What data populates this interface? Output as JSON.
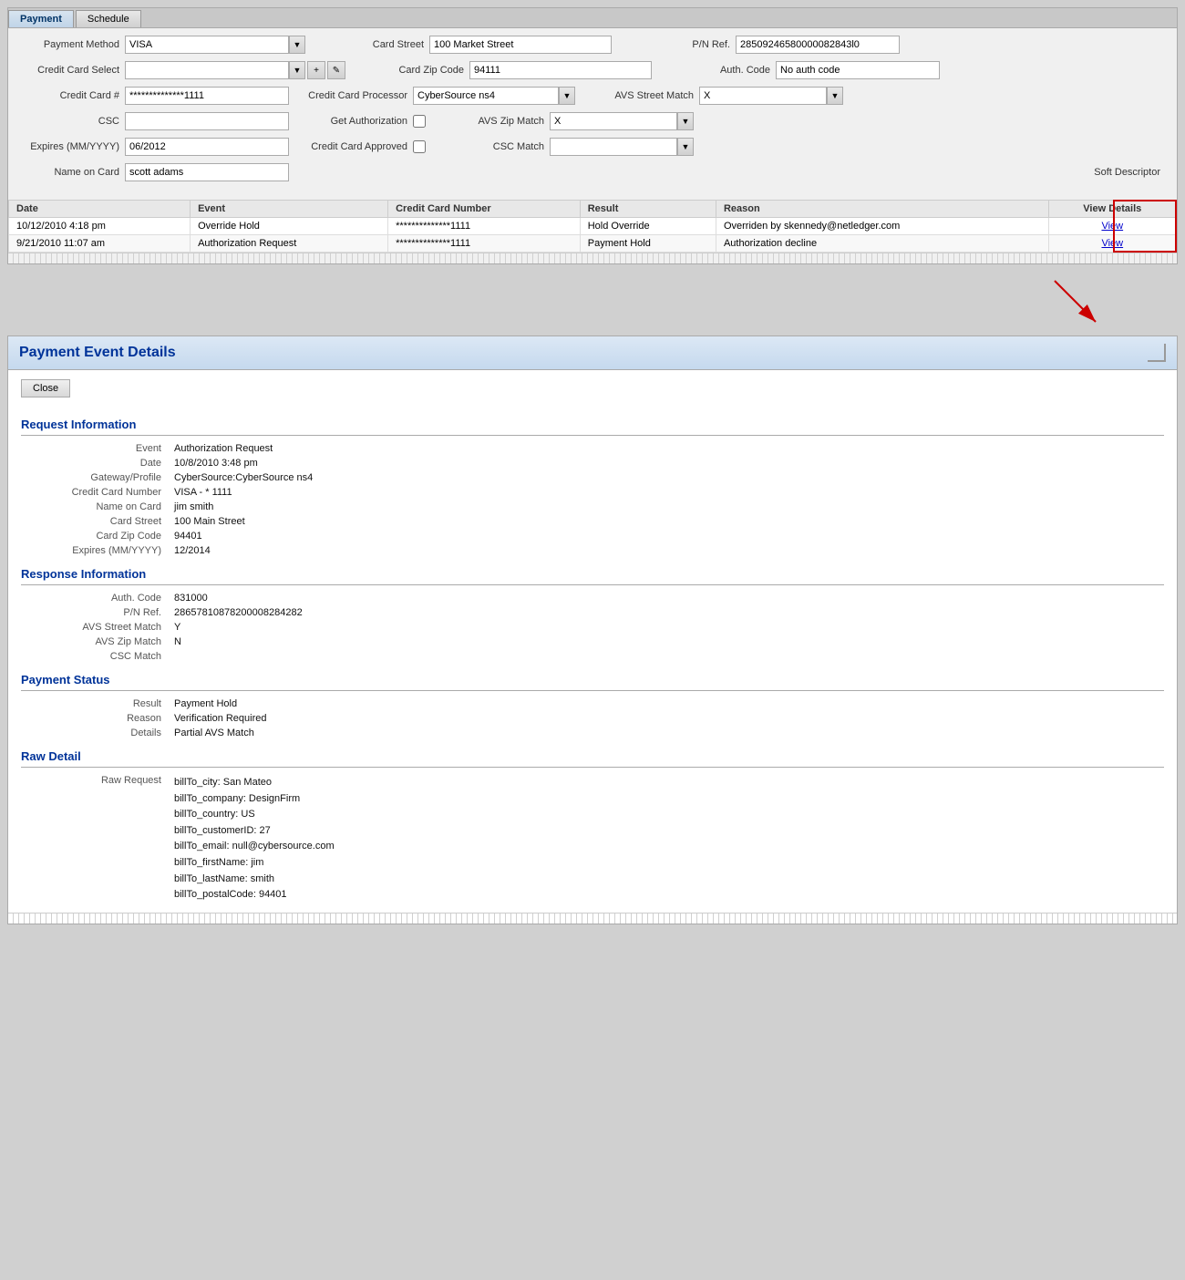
{
  "tabs": [
    {
      "label": "Payment",
      "active": true
    },
    {
      "label": "Schedule",
      "active": false
    }
  ],
  "payment_form": {
    "payment_method_label": "Payment Method",
    "payment_method_value": "VISA",
    "credit_card_select_label": "Credit Card Select",
    "credit_card_select_value": "",
    "credit_card_num_label": "Credit Card #",
    "credit_card_num_value": "**************1111",
    "csc_label": "CSC",
    "csc_value": "",
    "expires_label": "Expires (MM/YYYY)",
    "expires_value": "06/2012",
    "name_on_card_label": "Name on Card",
    "name_on_card_value": "scott adams",
    "card_street_label": "Card Street",
    "card_street_value": "100 Market Street",
    "card_zip_label": "Card Zip Code",
    "card_zip_value": "94111",
    "cc_processor_label": "Credit Card Processor",
    "cc_processor_value": "CyberSource ns4",
    "get_auth_label": "Get Authorization",
    "cc_approved_label": "Credit Card Approved",
    "pn_ref_label": "P/N Ref.",
    "pn_ref_value": "28509246580000082843l0",
    "auth_code_label": "Auth. Code",
    "auth_code_value": "No auth code",
    "avs_street_label": "AVS Street Match",
    "avs_street_value": "X",
    "avs_zip_label": "AVS Zip Match",
    "avs_zip_value": "X",
    "csc_match_label": "CSC Match",
    "csc_match_value": "",
    "soft_descriptor_label": "Soft Descriptor"
  },
  "history_table": {
    "columns": [
      "Date",
      "Event",
      "Credit Card Number",
      "Result",
      "Reason",
      "View Details"
    ],
    "rows": [
      {
        "date": "10/12/2010 4:18 pm",
        "event": "Override Hold",
        "cc_number": "**************1111",
        "result": "Hold Override",
        "reason": "Overriden by skennedy@netledger.com",
        "view": "View"
      },
      {
        "date": "9/21/2010 11:07 am",
        "event": "Authorization Request",
        "cc_number": "**************1111",
        "result": "Payment Hold",
        "reason": "Authorization decline",
        "view": "View"
      }
    ]
  },
  "detail_panel": {
    "title": "Payment Event Details",
    "close_button": "Close",
    "request_section": "Request Information",
    "request_fields": [
      {
        "label": "Event",
        "value": "Authorization Request"
      },
      {
        "label": "Date",
        "value": "10/8/2010 3:48 pm"
      },
      {
        "label": "Gateway/Profile",
        "value": "CyberSource:CyberSource ns4"
      },
      {
        "label": "Credit Card Number",
        "value": "VISA - * 1111"
      },
      {
        "label": "Name on Card",
        "value": "jim smith"
      },
      {
        "label": "Card Street",
        "value": "100 Main Street"
      },
      {
        "label": "Card Zip Code",
        "value": "94401"
      },
      {
        "label": "Expires (MM/YYYY)",
        "value": "12/2014"
      }
    ],
    "response_section": "Response Information",
    "response_fields": [
      {
        "label": "Auth. Code",
        "value": "831000"
      },
      {
        "label": "P/N Ref.",
        "value": "28657810878200008284282"
      },
      {
        "label": "AVS Street Match",
        "value": "Y"
      },
      {
        "label": "AVS Zip Match",
        "value": "N"
      },
      {
        "label": "CSC Match",
        "value": ""
      }
    ],
    "payment_status_section": "Payment Status",
    "payment_status_fields": [
      {
        "label": "Result",
        "value": "Payment Hold"
      },
      {
        "label": "Reason",
        "value": "Verification Required"
      },
      {
        "label": "Details",
        "value": "Partial AVS Match"
      }
    ],
    "raw_detail_section": "Raw Detail",
    "raw_request_label": "Raw Request",
    "raw_request_lines": [
      "billTo_city: San Mateo",
      "billTo_company: DesignFirm",
      "billTo_country: US",
      "billTo_customerID: 27",
      "billTo_email: null@cybersource.com",
      "billTo_firstName: jim",
      "billTo_lastName: smith",
      "billTo_postalCode: 94401"
    ]
  }
}
